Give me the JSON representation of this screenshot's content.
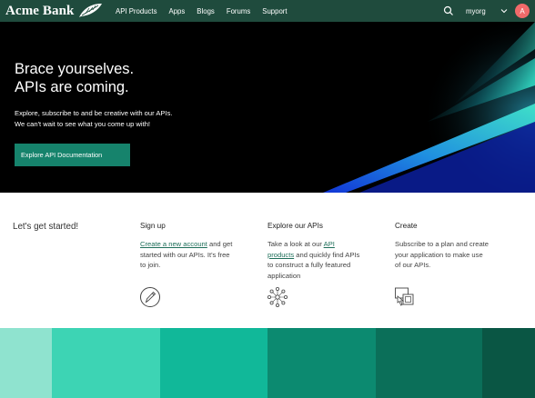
{
  "nav": {
    "brand": "Acme Bank",
    "links": [
      "API Products",
      "Apps",
      "Blogs",
      "Forums",
      "Support"
    ],
    "org": "myorg",
    "avatar_initial": "A"
  },
  "hero": {
    "title_lines": [
      "Brace yourselves.",
      "APIs are coming."
    ],
    "desc_lines": [
      "Explore, subscribe to and be creative with our APIs.",
      "We can't wait to see what you come up with!"
    ],
    "cta": "Explore API Documentation"
  },
  "started": {
    "heading": "Let's get started!",
    "signup": {
      "title": "Sign up",
      "link": "Create a new account",
      "text_l1_after": " and get",
      "text_l2": "started with our APIs. It's free",
      "text_l3": "to join.",
      "icon": "pencil-circle-icon"
    },
    "explore": {
      "title": "Explore our APIs",
      "text_l1_before": "Take a look at our ",
      "link_l1": "API",
      "link_l2": "products",
      "text_l2_after": " and quickly find APIs",
      "text_l3": "to construct a fully featured",
      "text_l4": "application",
      "icon": "network-icon"
    },
    "create": {
      "title": "Create",
      "text_l1": "Subscribe to a plan and create",
      "text_l2": "your application to make use",
      "text_l3": "of our APIs.",
      "icon": "touch-app-icon"
    }
  },
  "band_colors": [
    "#8fe3cf",
    "#3dd4b4",
    "#11b899",
    "#0c8a70",
    "#0b6f59",
    "#0a5644"
  ],
  "colors": {
    "nav_bg": "#1f4b3d",
    "cta_bg": "#16836c",
    "link": "#1f6f5a",
    "avatar": "#f06a6a"
  }
}
